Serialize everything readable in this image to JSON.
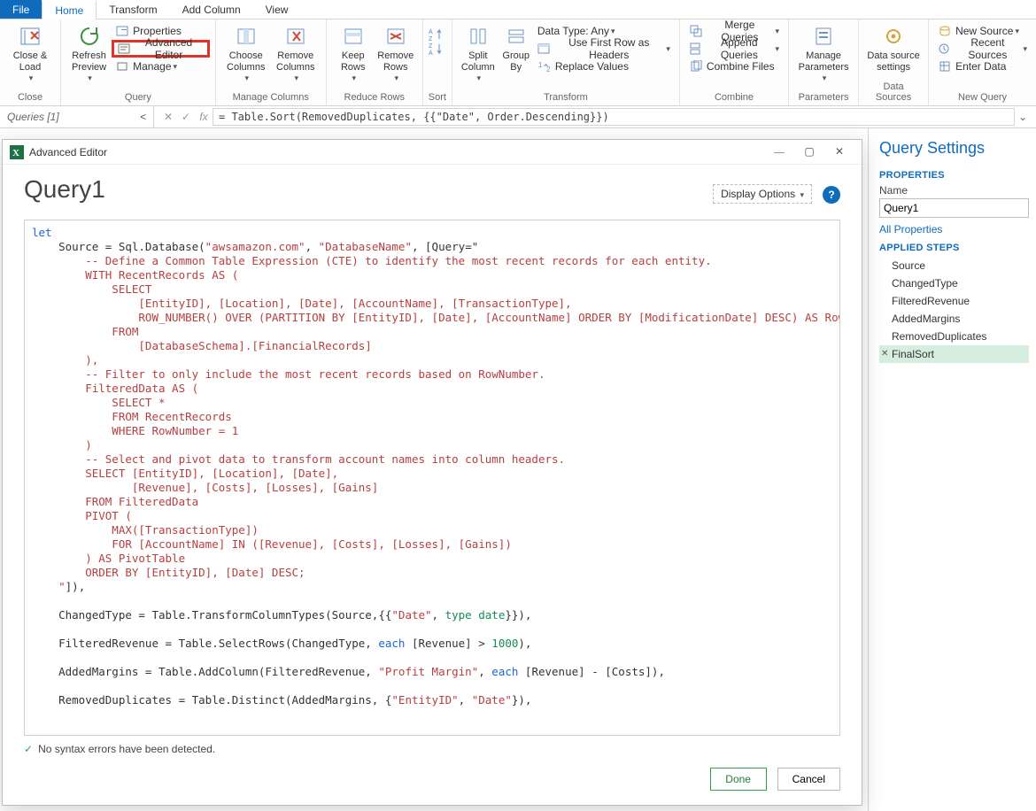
{
  "tabs": {
    "file": "File",
    "home": "Home",
    "transform": "Transform",
    "addColumn": "Add Column",
    "view": "View"
  },
  "ribbon": {
    "close": {
      "closeLoad": "Close &\nLoad",
      "group": "Close"
    },
    "query": {
      "refresh": "Refresh\nPreview",
      "properties": "Properties",
      "advanced": "Advanced Editor",
      "manage": "Manage",
      "group": "Query"
    },
    "manageCols": {
      "choose": "Choose\nColumns",
      "remove": "Remove\nColumns",
      "group": "Manage Columns"
    },
    "reduce": {
      "keep": "Keep\nRows",
      "remove": "Remove\nRows",
      "group": "Reduce Rows"
    },
    "sort": {
      "group": "Sort"
    },
    "transform": {
      "split": "Split\nColumn",
      "groupBy": "Group\nBy",
      "dataType": "Data Type: Any",
      "firstRow": "Use First Row as Headers",
      "replace": "Replace Values",
      "group": "Transform"
    },
    "combine": {
      "merge": "Merge Queries",
      "append": "Append Queries",
      "combineFiles": "Combine Files",
      "group": "Combine"
    },
    "params": {
      "manage": "Manage\nParameters",
      "group": "Parameters"
    },
    "ds": {
      "settings": "Data source\nsettings",
      "group": "Data Sources"
    },
    "newq": {
      "newSource": "New Source",
      "recent": "Recent Sources",
      "enter": "Enter Data",
      "group": "New Query"
    }
  },
  "queriesHeader": "Queries [1]",
  "formula": "= Table.Sort(RemovedDuplicates, {{\"Date\", Order.Descending}})",
  "settings": {
    "title": "Query Settings",
    "propHead": "PROPERTIES",
    "nameLabel": "Name",
    "name": "Query1",
    "allProps": "All Properties",
    "stepsHead": "APPLIED STEPS",
    "steps": [
      "Source",
      "ChangedType",
      "FilteredRevenue",
      "AddedMargins",
      "RemovedDuplicates",
      "FinalSort"
    ],
    "selectedStep": 5
  },
  "editor": {
    "windowTitle": "Advanced Editor",
    "heading": "Query1",
    "displayOptions": "Display Options",
    "status": "No syntax errors have been detected.",
    "done": "Done",
    "cancel": "Cancel",
    "code": {
      "let": "let",
      "srcA": "    Source = Sql.Database(",
      "srcHost": "\"awsamazon.com\"",
      "srcDb": "\"DatabaseName\"",
      "srcQ": ", [Query=\"",
      "sql": [
        "        -- Define a Common Table Expression (CTE) to identify the most recent records for each entity.",
        "        WITH RecentRecords AS (",
        "            SELECT",
        "                [EntityID], [Location], [Date], [AccountName], [TransactionType],",
        "                ROW_NUMBER() OVER (PARTITION BY [EntityID], [Date], [AccountName] ORDER BY [ModificationDate] DESC) AS RowNumber",
        "            FROM",
        "                [DatabaseSchema].[FinancialRecords]",
        "        ),",
        "        -- Filter to only include the most recent records based on RowNumber.",
        "        FilteredData AS (",
        "            SELECT *",
        "            FROM RecentRecords",
        "            WHERE RowNumber = 1",
        "        )",
        "        -- Select and pivot data to transform account names into column headers.",
        "        SELECT [EntityID], [Location], [Date],",
        "               [Revenue], [Costs], [Losses], [Gains]",
        "        FROM FilteredData",
        "        PIVOT (",
        "            MAX([TransactionType])",
        "            FOR [AccountName] IN ([Revenue], [Costs], [Losses], [Gains])",
        "        ) AS PivotTable",
        "        ORDER BY [EntityID], [Date] DESC;"
      ],
      "srcEnd": "    \"]),",
      "blank": "",
      "ct": "    ChangedType = Table.TransformColumnTypes(Source,{{",
      "ctDate": "\"Date\"",
      "ctMid": ", ",
      "ctType": "type date",
      "ctEnd": "}}),",
      "fr": "    FilteredRevenue = Table.SelectRows(ChangedType, ",
      "frEach": "each",
      "frMid": " [Revenue] > ",
      "frNum": "1000",
      "frEnd": "),",
      "am": "    AddedMargins = Table.AddColumn(FilteredRevenue, ",
      "amStr": "\"Profit Margin\"",
      "amMid": ", ",
      "amEach": "each",
      "amExpr": " [Revenue] - [Costs]),",
      "rd": "    RemovedDuplicates = Table.Distinct(AddedMargins, {",
      "rdA": "\"EntityID\"",
      "rdC": ", ",
      "rdB": "\"Date\"",
      "rdEnd": "}),"
    }
  }
}
